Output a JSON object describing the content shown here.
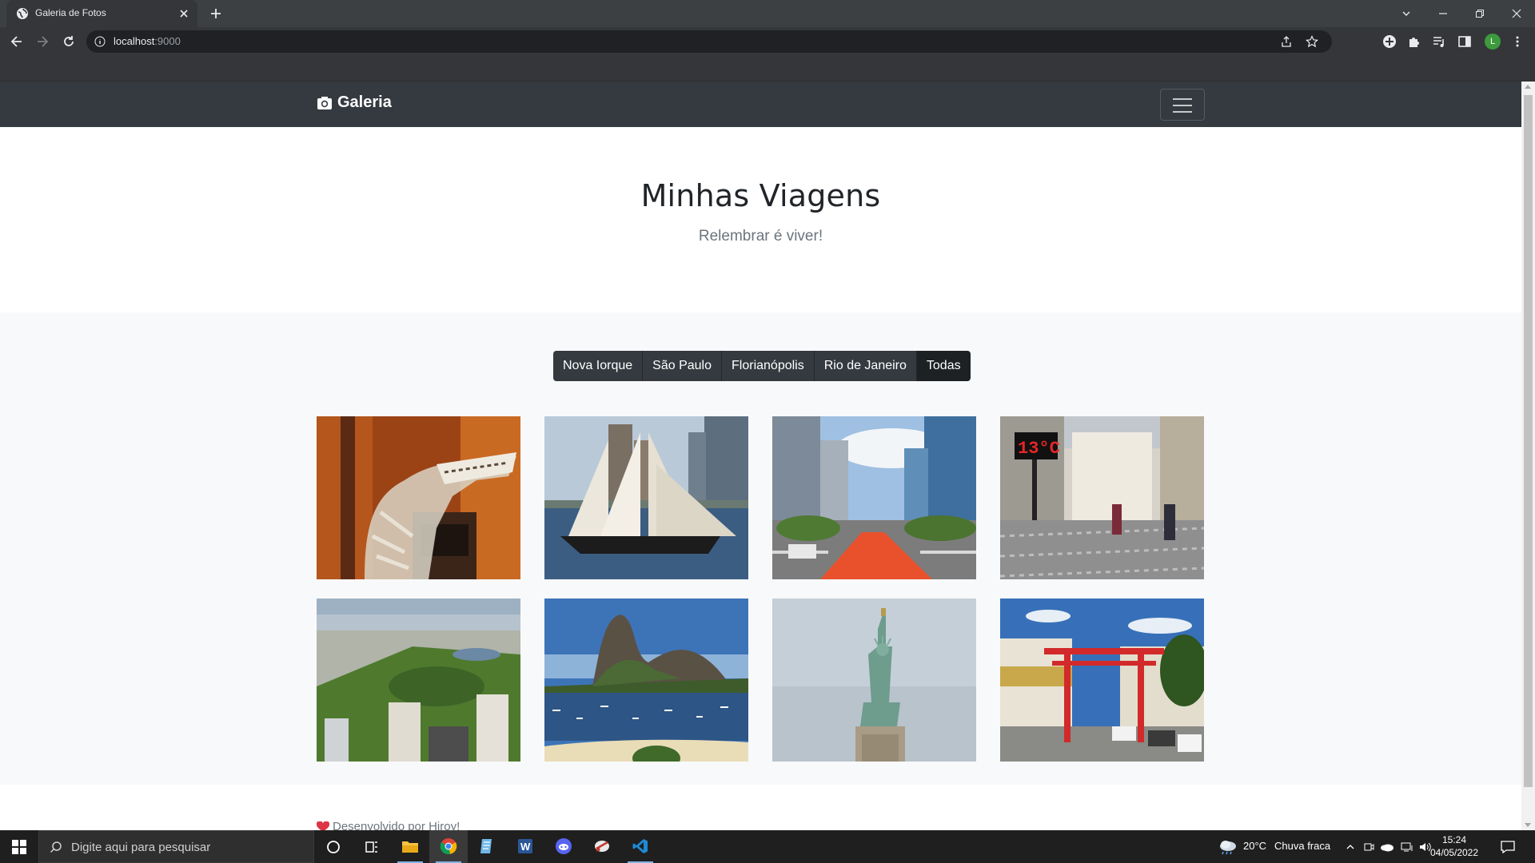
{
  "browser": {
    "tab_title": "Galeria de Fotos",
    "url_host": "localhost",
    "url_port": ":9000"
  },
  "navbar": {
    "brand": "Galeria"
  },
  "hero": {
    "title": "Minhas Viagens",
    "subtitle": "Relembrar é viver!"
  },
  "filters": [
    {
      "label": "Nova Iorque"
    },
    {
      "label": "São Paulo"
    },
    {
      "label": "Florianópolis"
    },
    {
      "label": "Rio de Janeiro"
    },
    {
      "label": "Todas"
    }
  ],
  "photos": [
    {
      "subject": "dinosaur skeleton",
      "palette": [
        "#8a3a18",
        "#c8651f"
      ]
    },
    {
      "subject": "sailing ship",
      "palette": [
        "#3c5f86",
        "#8aa6c0"
      ]
    },
    {
      "subject": "avenue with red bike lane",
      "palette": [
        "#6d8fb3",
        "#bcd2e6"
      ]
    },
    {
      "subject": "pedestrian street with thermometer 13°C",
      "palette": [
        "#b7b2ab",
        "#7b8a98"
      ],
      "overlay_text": "13°C"
    },
    {
      "subject": "Central Park aerial",
      "palette": [
        "#5a7d3a",
        "#a9bfcf"
      ]
    },
    {
      "subject": "Sugarloaf mountain bay",
      "palette": [
        "#3b6aa3",
        "#9cc0e0"
      ]
    },
    {
      "subject": "Statue of Liberty",
      "palette": [
        "#b6c2cc",
        "#e4e8ec"
      ]
    },
    {
      "subject": "red torii gate street",
      "palette": [
        "#2e6bb3",
        "#6b9bd3"
      ]
    }
  ],
  "footer": {
    "text": "Desenvolvido por Hiroy!"
  },
  "taskbar": {
    "search_placeholder": "Digite aqui para pesquisar",
    "weather_temp": "20°C",
    "weather_desc": "Chuva fraca",
    "time": "15:24",
    "date": "04/05/2022"
  },
  "colors": {
    "navbar_bg": "#343a40",
    "album_bg": "#f8f9fa",
    "active_filter": "#1d2124",
    "chrome_dark": "#35363a"
  }
}
